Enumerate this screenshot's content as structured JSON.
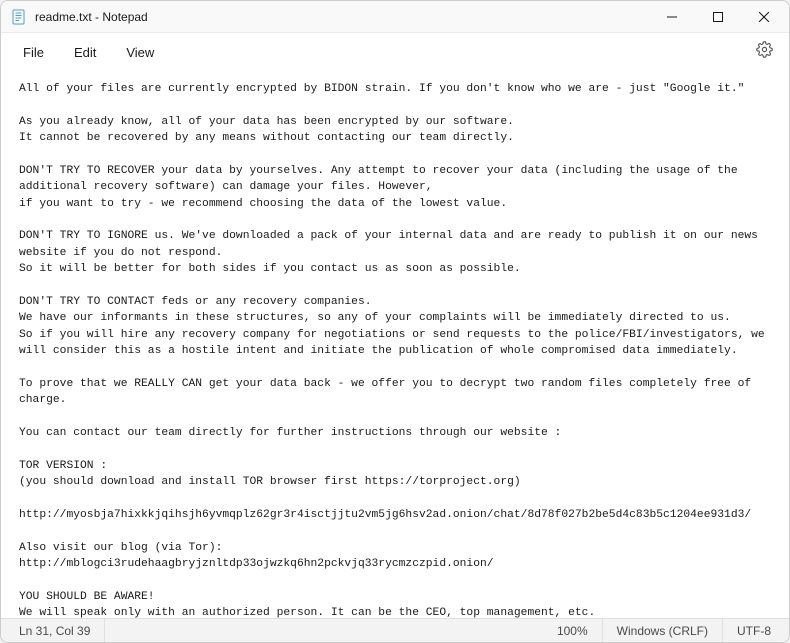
{
  "titlebar": {
    "title": "readme.txt - Notepad"
  },
  "menu": {
    "file": "File",
    "edit": "Edit",
    "view": "View"
  },
  "content": {
    "text": "All of your files are currently encrypted by BIDON strain. If you don't know who we are - just \"Google it.\"\n\nAs you already know, all of your data has been encrypted by our software.\nIt cannot be recovered by any means without contacting our team directly.\n\nDON'T TRY TO RECOVER your data by yourselves. Any attempt to recover your data (including the usage of the additional recovery software) can damage your files. However,\nif you want to try - we recommend choosing the data of the lowest value.\n\nDON'T TRY TO IGNORE us. We've downloaded a pack of your internal data and are ready to publish it on our news website if you do not respond.\nSo it will be better for both sides if you contact us as soon as possible.\n\nDON'T TRY TO CONTACT feds or any recovery companies.\nWe have our informants in these structures, so any of your complaints will be immediately directed to us.\nSo if you will hire any recovery company for negotiations or send requests to the police/FBI/investigators, we will consider this as a hostile intent and initiate the publication of whole compromised data immediately.\n\nTo prove that we REALLY CAN get your data back - we offer you to decrypt two random files completely free of charge.\n\nYou can contact our team directly for further instructions through our website :\n\nTOR VERSION :\n(you should download and install TOR browser first https://torproject.org)\n\nhttp://myosbja7hixkkjqihsjh6yvmqplz62gr3r4isctjjtu2vm5jg6hsv2ad.onion/chat/8d78f027b2be5d4c83b5c1204ee931d3/\n\nAlso visit our blog (via Tor):\nhttp://mblogci3rudehaagbryjznltdp33ojwzkq6hn2pckvjq33rycmzczpid.onion/\n\nYOU SHOULD BE AWARE!\nWe will speak only with an authorized person. It can be the CEO, top management, etc.\nIn case you are not such a person - DON'T CONTACT US! Your decisions and action can result in serious harm to your company!\nInform your supervisors and stay calm!"
  },
  "statusbar": {
    "position": "Ln 31, Col 39",
    "zoom": "100%",
    "line_ending": "Windows (CRLF)",
    "encoding": "UTF-8"
  }
}
